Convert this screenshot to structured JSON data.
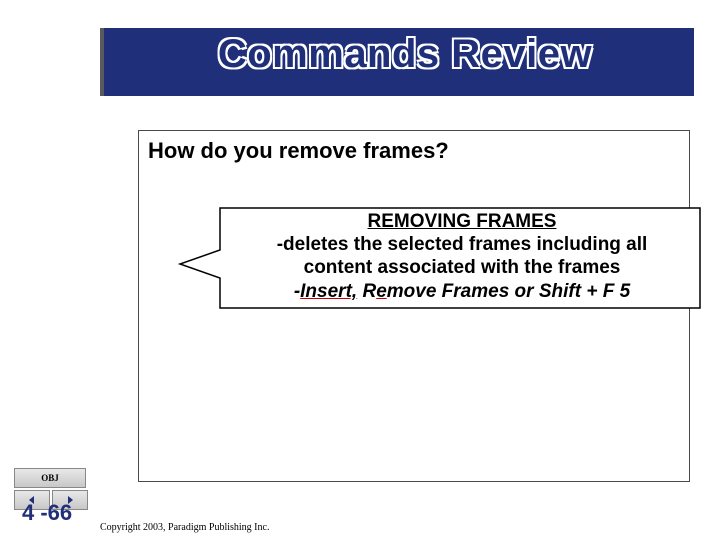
{
  "title": "Commands Review",
  "question": "How do you remove frames?",
  "callout": {
    "heading": "REMOVING FRAMES",
    "line1": "-deletes the selected frames including all",
    "line2": "content associated with the frames",
    "line3_prefix": "-",
    "line3_insert": "Insert,",
    "line3_mid": " R",
    "line3_e": "e",
    "line3_rest": "move Frames or Shift + F 5"
  },
  "nav": {
    "obj_label": "OBJ"
  },
  "page_number": "4 -66",
  "copyright": "Copyright 2003, Paradigm Publishing Inc."
}
